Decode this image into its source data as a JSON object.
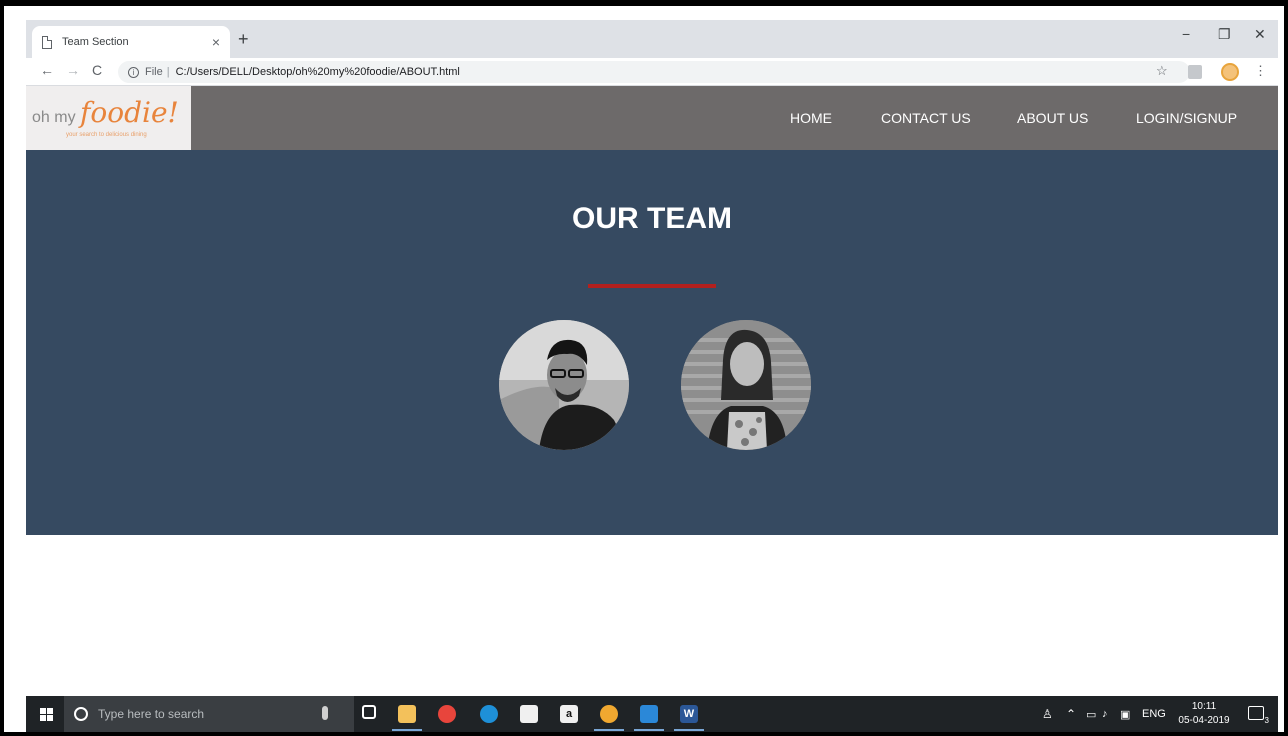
{
  "browser": {
    "tab_title": "Team Section",
    "tab_close": "×",
    "new_tab": "+",
    "window_controls": {
      "minimize": "−",
      "maximize": "❐",
      "close": "✕"
    },
    "nav": {
      "back": "←",
      "forward": "→",
      "reload": "C"
    },
    "address": {
      "info": "i",
      "scheme_label": "File",
      "separator": "|",
      "url": "C:/Users/DELL/Desktop/oh%20my%20foodie/ABOUT.html"
    },
    "bookmark_star": "☆",
    "menu_dots": "⋮"
  },
  "site": {
    "logo": {
      "oh_my": "oh my ",
      "brand": "foodie!",
      "tagline": "your search to delicious dining"
    },
    "menu": [
      {
        "label": "HOME"
      },
      {
        "label": "CONTACT US"
      },
      {
        "label": "ABOUT US"
      },
      {
        "label": "LOGIN/SIGNUP"
      }
    ],
    "hero": {
      "title": "OUR TEAM",
      "accent_color": "#b3201e",
      "background": "#364a61"
    }
  },
  "taskbar": {
    "search_placeholder": "Type here to search",
    "apps": [
      "mic-icon",
      "task-view-icon",
      "file-explorer-icon",
      "chrome-icon",
      "edge-icon",
      "store-icon",
      "amazon-icon",
      "chrome-canary-icon",
      "vscode-icon",
      "word-icon"
    ],
    "amazon_label": "a",
    "word_label": "W",
    "tray": {
      "language": "ENG",
      "time": "10:11",
      "date": "05-04-2019",
      "notifications": "3"
    }
  }
}
